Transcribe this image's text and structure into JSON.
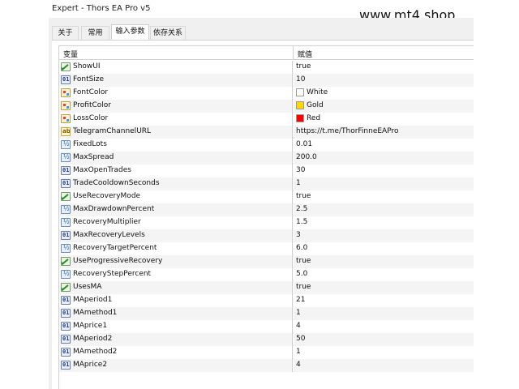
{
  "window": {
    "title": "Expert - Thors EA Pro v5"
  },
  "watermark": "www.mt4.shop",
  "tabs": [
    {
      "label": "关于",
      "active": false
    },
    {
      "label": "常用",
      "active": false
    },
    {
      "label": "输入参数",
      "active": true
    },
    {
      "label": "依存关系",
      "active": false
    }
  ],
  "grid": {
    "headers": {
      "variable": "变量",
      "value": "赋值"
    },
    "rows": [
      {
        "icon": "bool-icon",
        "name": "ShowUI",
        "value": "true"
      },
      {
        "icon": "int-icon",
        "name": "FontSize",
        "value": "10"
      },
      {
        "icon": "color-icon",
        "name": "FontColor",
        "value": "White",
        "swatch": "#ffffff"
      },
      {
        "icon": "color-icon",
        "name": "ProfitColor",
        "value": "Gold",
        "swatch": "#ffd700"
      },
      {
        "icon": "color-icon",
        "name": "LossColor",
        "value": "Red",
        "swatch": "#ff0000"
      },
      {
        "icon": "string-icon",
        "name": "TelegramChannelURL",
        "value": "https://t.me/ThorFinneEAPro"
      },
      {
        "icon": "double-icon",
        "name": "FixedLots",
        "value": "0.01"
      },
      {
        "icon": "double-icon",
        "name": "MaxSpread",
        "value": "200.0"
      },
      {
        "icon": "int-icon",
        "name": "MaxOpenTrades",
        "value": "30"
      },
      {
        "icon": "int-icon",
        "name": "TradeCooldownSeconds",
        "value": "1"
      },
      {
        "icon": "bool-icon",
        "name": "UseRecoveryMode",
        "value": "true"
      },
      {
        "icon": "double-icon",
        "name": "MaxDrawdownPercent",
        "value": "2.5"
      },
      {
        "icon": "double-icon",
        "name": "RecoveryMultiplier",
        "value": "1.5"
      },
      {
        "icon": "int-icon",
        "name": "MaxRecoveryLevels",
        "value": "3"
      },
      {
        "icon": "double-icon",
        "name": "RecoveryTargetPercent",
        "value": "6.0"
      },
      {
        "icon": "bool-icon",
        "name": "UseProgressiveRecovery",
        "value": "true"
      },
      {
        "icon": "double-icon",
        "name": "RecoveryStepPercent",
        "value": "5.0"
      },
      {
        "icon": "bool-icon",
        "name": "UsesMA",
        "value": "true"
      },
      {
        "icon": "int-icon",
        "name": "MAperiod1",
        "value": "21"
      },
      {
        "icon": "int-icon",
        "name": "MAmethod1",
        "value": "1"
      },
      {
        "icon": "int-icon",
        "name": "MAprice1",
        "value": "4"
      },
      {
        "icon": "int-icon",
        "name": "MAperiod2",
        "value": "50"
      },
      {
        "icon": "int-icon",
        "name": "MAmethod2",
        "value": "1"
      },
      {
        "icon": "int-icon",
        "name": "MAprice2",
        "value": "4"
      }
    ]
  }
}
